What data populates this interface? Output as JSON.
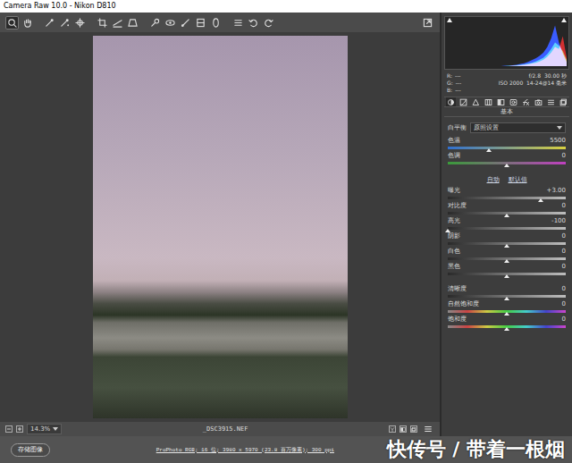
{
  "window": {
    "title": "Camera Raw 10.0 - Nikon D810"
  },
  "toolbar": {
    "tools": [
      {
        "kind": "zoom",
        "selected": true
      },
      {
        "kind": "hand",
        "selected": false
      },
      {
        "kind": "white-balance",
        "selected": false
      },
      {
        "kind": "color-sampler",
        "selected": false
      },
      {
        "kind": "targeted-adjust",
        "selected": false
      },
      {
        "kind": "crop",
        "selected": false
      },
      {
        "kind": "straighten",
        "selected": false
      },
      {
        "kind": "transform",
        "selected": false
      },
      {
        "kind": "spot-removal",
        "selected": false
      },
      {
        "kind": "red-eye",
        "selected": false
      },
      {
        "kind": "brush",
        "selected": false
      },
      {
        "kind": "graduated-filter",
        "selected": false
      },
      {
        "kind": "radial-filter",
        "selected": false
      },
      {
        "kind": "preferences",
        "selected": false
      },
      {
        "kind": "rotate-left",
        "selected": false
      },
      {
        "kind": "rotate-right",
        "selected": false
      }
    ]
  },
  "histogram": {
    "series": [
      {
        "color": "#d23030",
        "values": [
          0,
          0,
          0,
          0,
          0,
          0,
          0,
          0,
          0,
          0,
          0,
          0,
          0,
          0,
          0,
          0,
          0,
          1,
          1,
          2,
          3,
          4,
          6,
          8,
          11,
          15,
          22,
          32,
          45,
          40,
          70,
          20
        ]
      },
      {
        "color": "#30b040",
        "values": [
          0,
          0,
          0,
          0,
          0,
          0,
          0,
          0,
          0,
          0,
          0,
          0,
          0,
          0,
          0,
          0,
          1,
          1,
          2,
          3,
          4,
          6,
          8,
          11,
          15,
          20,
          28,
          40,
          55,
          48,
          35,
          15
        ]
      },
      {
        "color": "#3a5cff",
        "values": [
          0,
          0,
          0,
          0,
          0,
          0,
          0,
          0,
          0,
          0,
          0,
          0,
          0,
          0,
          0,
          1,
          1,
          2,
          3,
          5,
          7,
          10,
          14,
          18,
          24,
          32,
          45,
          65,
          95,
          55,
          30,
          10
        ]
      }
    ],
    "readouts": [
      {
        "label": "R:",
        "value": "---"
      },
      {
        "label": "G:",
        "value": "---"
      },
      {
        "label": "B:",
        "value": "---"
      }
    ],
    "camera_info": [
      "f/2.8  30.00 秒",
      "ISO 2000  14-24@14 毫米"
    ]
  },
  "panel_tabs": [
    {
      "kind": "basic",
      "selected": true
    },
    {
      "kind": "tone-curve",
      "selected": false
    },
    {
      "kind": "detail",
      "selected": false
    },
    {
      "kind": "hsl",
      "selected": false
    },
    {
      "kind": "split-toning",
      "selected": false
    },
    {
      "kind": "lens",
      "selected": false
    },
    {
      "kind": "effects",
      "selected": false
    },
    {
      "kind": "camera",
      "selected": false
    },
    {
      "kind": "presets",
      "selected": false
    },
    {
      "kind": "snapshots",
      "selected": false
    }
  ],
  "panel": {
    "title": "基本",
    "white_balance": {
      "label": "白平衡",
      "value": "原照设置"
    },
    "groups": [
      {
        "links": [],
        "sliders": [
          {
            "label": "色温",
            "reading": "5500",
            "level": 0.35,
            "kind": "temperature"
          },
          {
            "label": "色调",
            "reading": "0",
            "level": 0.5,
            "kind": "tint"
          }
        ]
      },
      {
        "links": [
          "自动",
          "默认值"
        ],
        "sliders": [
          {
            "label": "曝光",
            "reading": "+3.00",
            "level": 0.79,
            "kind": "tone"
          },
          {
            "label": "对比度",
            "reading": "0",
            "level": 0.5,
            "kind": "tone"
          },
          {
            "label": "高光",
            "reading": "-100",
            "level": 0,
            "kind": "tone"
          },
          {
            "label": "阴影",
            "reading": "0",
            "level": 0.5,
            "kind": "tone"
          },
          {
            "label": "白色",
            "reading": "0",
            "level": 0.5,
            "kind": "tone"
          },
          {
            "label": "黑色",
            "reading": "0",
            "level": 0.5,
            "kind": "tone"
          }
        ]
      },
      {
        "links": [],
        "sliders": [
          {
            "label": "清晰度",
            "reading": "0",
            "level": 0.5,
            "kind": "tone"
          },
          {
            "label": "自然饱和度",
            "reading": "0",
            "level": 0.5,
            "kind": "saturation"
          },
          {
            "label": "饱和度",
            "reading": "0",
            "level": 0.5,
            "kind": "saturation"
          }
        ]
      }
    ]
  },
  "status": {
    "zoom": "14.3%",
    "filename": "_DSC3915.NEF"
  },
  "footer": {
    "save_button": "存储图像",
    "workflow": "ProPhoto RGB; 16 位; 3980 x 5970 (23.8 百万像素); 300 ppi",
    "watermark": "快传号 / 带着一根烟"
  }
}
